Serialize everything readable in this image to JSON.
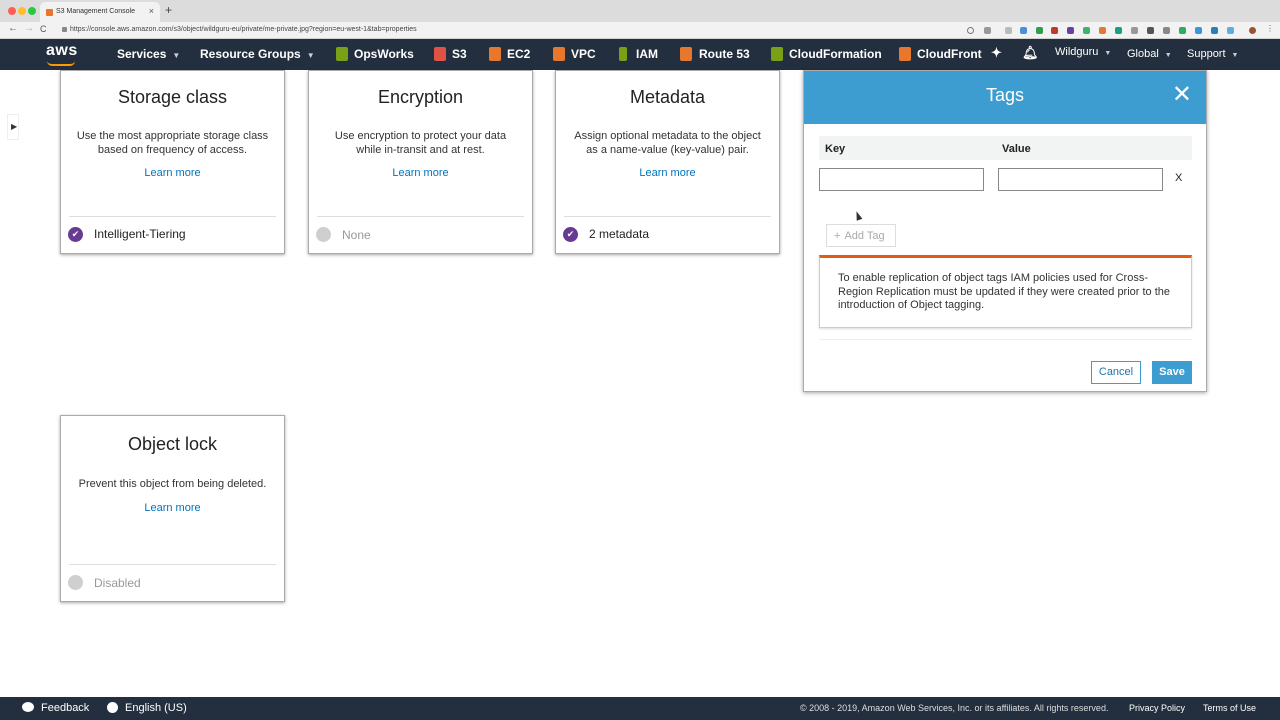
{
  "browser": {
    "tab_title": "S3 Management Console",
    "tab_close": "×",
    "new_tab": "+",
    "url": "https://console.aws.amazon.com/s3/object/wildguru-eu/private/me-private.jpg?region=eu-west-1&tab=properties",
    "back": "←",
    "forward": "→",
    "reload": "C"
  },
  "header": {
    "logo": "aws",
    "services": "Services",
    "resource_groups": "Resource Groups",
    "shortcuts": [
      {
        "label": "OpsWorks",
        "color": "#7aa116"
      },
      {
        "label": "S3",
        "color": "#e05243"
      },
      {
        "label": "EC2",
        "color": "#e8772e"
      },
      {
        "label": "VPC",
        "color": "#e8772e"
      },
      {
        "label": "IAM",
        "color": "#7aa116"
      },
      {
        "label": "Route 53",
        "color": "#e8772e"
      },
      {
        "label": "CloudFormation",
        "color": "#7aa116"
      },
      {
        "label": "CloudFront",
        "color": "#e8772e"
      }
    ],
    "user": "Wildguru",
    "region": "Global",
    "support": "Support"
  },
  "cards": {
    "storage_class": {
      "title": "Storage class",
      "description": "Use the most appropriate storage class based on frequency of access.",
      "link": "Learn more",
      "status": "Intelligent-Tiering"
    },
    "encryption": {
      "title": "Encryption",
      "description": "Use encryption to protect your data while in-transit and at rest.",
      "link": "Learn more",
      "status": "None"
    },
    "metadata": {
      "title": "Metadata",
      "description": "Assign optional metadata to the object as a name-value (key-value) pair.",
      "link": "Learn more",
      "status": "2 metadata"
    },
    "object_lock": {
      "title": "Object lock",
      "description": "Prevent this object from being deleted.",
      "link": "Learn more",
      "status": "Disabled"
    }
  },
  "tags_panel": {
    "title": "Tags",
    "close": "✕",
    "key_header": "Key",
    "value_header": "Value",
    "key_value": "",
    "value_value": "",
    "remove_row": "X",
    "add_tag": "Add Tag",
    "alert": "To enable replication of object tags IAM policies used for Cross-Region Replication must be updated if they were created prior to the introduction of Object tagging.",
    "cancel": "Cancel",
    "save": "Save"
  },
  "footer": {
    "feedback": "Feedback",
    "language": "English (US)",
    "copyright": "© 2008 - 2019, Amazon Web Services, Inc. or its affiliates. All rights reserved.",
    "privacy": "Privacy Policy",
    "terms": "Terms of Use"
  },
  "colors": {
    "aws_nav": "#232f3e",
    "tags_header": "#3d9dd0",
    "check": "#693a93",
    "link": "#0073bb",
    "alert_border": "#e35c13"
  }
}
